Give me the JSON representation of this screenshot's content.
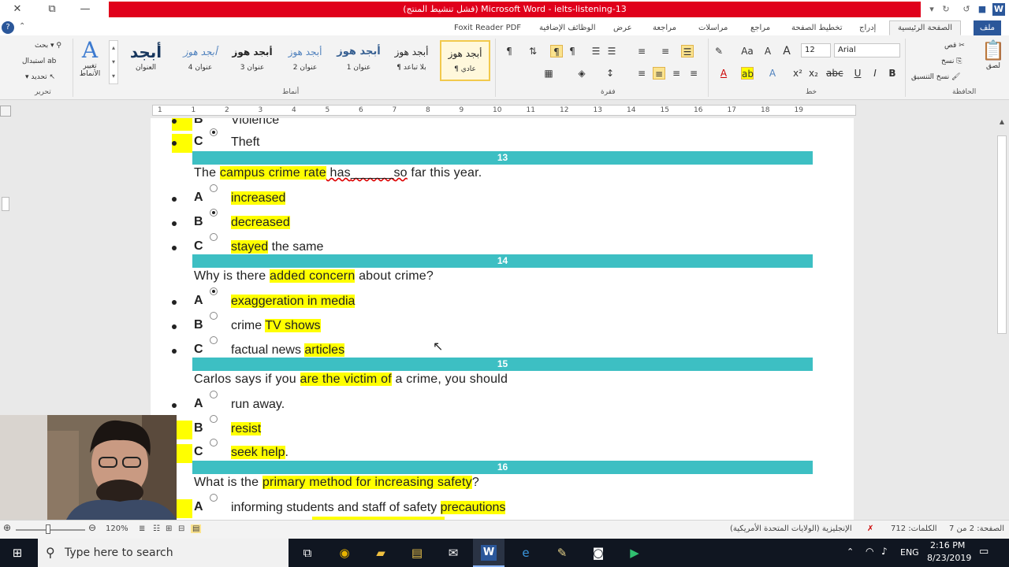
{
  "title_bar": {
    "title": "(فشل تنشيط المنتج) Microsoft Word - ielts-listening-13",
    "minimize": "—",
    "restore": "⧉",
    "close": "✕"
  },
  "tabs": {
    "file": "ملف",
    "items": [
      "الصفحة الرئيسية",
      "إدراج",
      "تخطيط الصفحة",
      "مراجع",
      "مراسلات",
      "مراجعة",
      "عرض",
      "الوظائف الإضافية",
      "Foxit Reader PDF"
    ]
  },
  "ribbon": {
    "groups": {
      "clipboard": "الحافظة",
      "font": "خط",
      "paragraph": "فقرة",
      "styles": "أنماط",
      "editing": "تحرير"
    },
    "clipboard": {
      "paste": "لصق",
      "cut": "قص",
      "copy": "نسخ",
      "format_painter": "نسخ التنسيق"
    },
    "font": {
      "name": "Arial",
      "size": "12"
    },
    "styles": [
      {
        "preview": "أبجد هوز",
        "name": "¶ عادي"
      },
      {
        "preview": "أبجد هوز",
        "name": "¶ بلا تباعد"
      },
      {
        "preview": "أبجد هوز",
        "name": "عنوان 1"
      },
      {
        "preview": "أبجد هوز",
        "name": "عنوان 2"
      },
      {
        "preview": "أبجد هوز",
        "name": "عنوان 3"
      },
      {
        "preview": "أبجد هوز",
        "name": "عنوان 4"
      },
      {
        "preview": "أبجد",
        "name": "العنوان"
      }
    ],
    "change_styles": "تغيير الأنماط",
    "editing": {
      "find": "بحث",
      "replace": "استبدال",
      "select": "تحديد"
    }
  },
  "ruler": {
    "numbers": [
      "1",
      "1",
      "2",
      "3",
      "4",
      "5",
      "6",
      "7",
      "8",
      "9",
      "10",
      "11",
      "12",
      "13",
      "14",
      "15",
      "16",
      "17",
      "18",
      "19"
    ]
  },
  "document": {
    "prev_items": [
      {
        "letter": "B",
        "text": "Violence"
      },
      {
        "letter": "C",
        "text": "Theft",
        "selected": true
      }
    ],
    "questions": [
      {
        "number": "13",
        "parts": [
          {
            "t": "The ",
            "hl": false
          },
          {
            "t": "campus crime rate",
            "hl": true
          },
          {
            "t": " has",
            "hl": false,
            "sp": true
          },
          {
            "t": "______",
            "hl": false,
            "sp": true
          },
          {
            "t": "so",
            "hl": false,
            "sp": true
          },
          {
            "t": " far this year.",
            "hl": false
          }
        ],
        "options": [
          {
            "letter": "A",
            "parts": [
              {
                "t": "increased",
                "hl": true
              }
            ],
            "selected": false
          },
          {
            "letter": "B",
            "parts": [
              {
                "t": "decreased",
                "hl": true
              }
            ],
            "selected": true
          },
          {
            "letter": "C",
            "parts": [
              {
                "t": "stayed",
                "hl": true
              },
              {
                "t": " the same",
                "hl": false
              }
            ],
            "selected": false
          }
        ]
      },
      {
        "number": "14",
        "parts": [
          {
            "t": "Why is there ",
            "hl": false
          },
          {
            "t": "added concern",
            "hl": true
          },
          {
            "t": " about crime?",
            "hl": false
          }
        ],
        "options": [
          {
            "letter": "A",
            "parts": [
              {
                "t": "exaggeration in media",
                "hl": true
              }
            ],
            "selected": true
          },
          {
            "letter": "B",
            "parts": [
              {
                "t": "crime ",
                "hl": false
              },
              {
                "t": "TV shows",
                "hl": true
              }
            ],
            "selected": false
          },
          {
            "letter": "C",
            "parts": [
              {
                "t": "factual news ",
                "hl": false
              },
              {
                "t": "articles",
                "hl": true
              }
            ],
            "selected": false
          }
        ]
      },
      {
        "number": "15",
        "parts": [
          {
            "t": "Carlos says if you ",
            "hl": false
          },
          {
            "t": "are the victim of",
            "hl": true
          },
          {
            "t": " a crime, you should",
            "hl": false
          }
        ],
        "options": [
          {
            "letter": "A",
            "parts": [
              {
                "t": "run away.",
                "hl": false
              }
            ],
            "selected": false
          },
          {
            "letter": "B",
            "parts": [
              {
                "t": "resist",
                "hl": true
              }
            ],
            "selected": false
          },
          {
            "letter": "C",
            "parts": [
              {
                "t": "seek help",
                "hl": true
              },
              {
                "t": ".",
                "hl": false
              }
            ],
            "selected": false
          }
        ]
      },
      {
        "number": "16",
        "parts": [
          {
            "t": "What is the ",
            "hl": false
          },
          {
            "t": "primary method for increasing safety",
            "hl": true
          },
          {
            "t": "?",
            "hl": false
          }
        ],
        "options": [
          {
            "letter": "A",
            "parts": [
              {
                "t": "informing students and staff of safety ",
                "hl": false
              },
              {
                "t": "precautions",
                "hl": true
              }
            ],
            "selected": false
          }
        ]
      }
    ]
  },
  "status_bar": {
    "page": "الصفحة: 2 من 7",
    "words": "الكلمات: 712",
    "language": "الإنجليزية (الولايات المتحدة الأمريكية)",
    "zoom": "120%"
  },
  "taskbar": {
    "search_placeholder": "Type here to search",
    "language": "ENG",
    "time": "2:16 PM",
    "date": "8/23/2019"
  },
  "colors": {
    "title_red": "#e0001b",
    "band_teal": "#3dbfc3",
    "highlight": "#ffff00",
    "word_blue": "#2b579a"
  }
}
